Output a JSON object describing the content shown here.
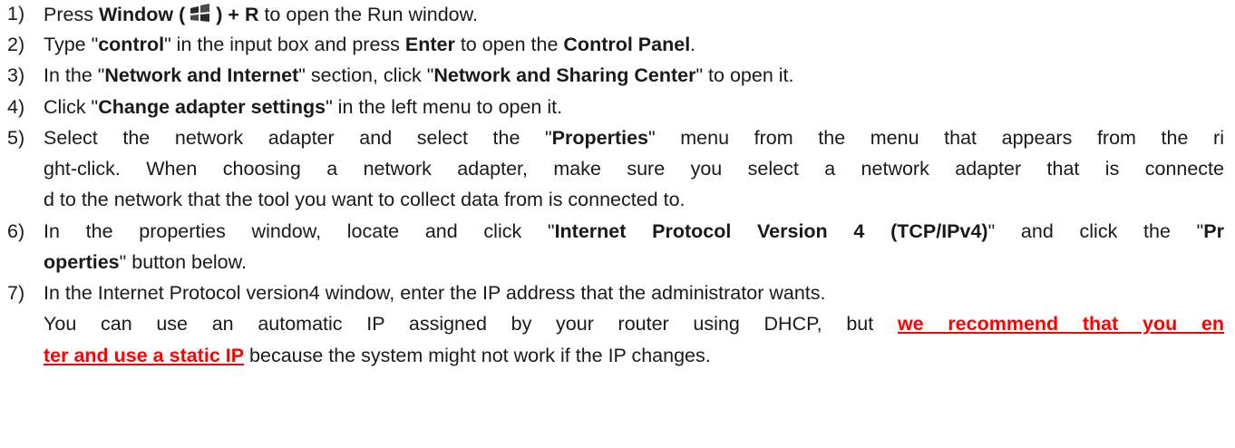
{
  "steps": [
    {
      "num": "1)",
      "lines": [
        [
          "Press ",
          {
            "b": "Window ("
          },
          "ICON",
          {
            "b": ") + R"
          },
          " to open the Run window."
        ]
      ]
    },
    {
      "num": "2)",
      "lines": [
        [
          "Type \"",
          {
            "b": "control"
          },
          "\" in the input box and press ",
          {
            "b": "Enter"
          },
          " to open the ",
          {
            "b": "Control Panel"
          },
          "."
        ]
      ]
    },
    {
      "num": "3)",
      "lines": [
        [
          "In the \"",
          {
            "b": "Network and Internet"
          },
          "\" section, click \"",
          {
            "b": "Network and Sharing Center"
          },
          "\" to open it."
        ]
      ]
    },
    {
      "num": "4)",
      "lines": [
        [
          "Click \"",
          {
            "b": "Change adapter settings"
          },
          "\" in the left menu to open it."
        ]
      ]
    },
    {
      "num": "5)",
      "lines": [
        [
          "Select the network adapter and select the \"",
          {
            "b": "Properties"
          },
          "\" menu from the menu that appears from the ri"
        ],
        [
          "ght-click. When choosing a network adapter, make sure you select a network adapter that is connecte"
        ],
        [
          "d to the network that the tool you want to collect data from is connected to."
        ]
      ]
    },
    {
      "num": "6)",
      "lines": [
        [
          "In the properties window, locate and click \"",
          {
            "b": "Internet Protocol Version 4 (TCP/IPv4)"
          },
          "\" and click the \"",
          {
            "b": "Pr"
          }
        ],
        [
          {
            "b": "operties"
          },
          "\" button below."
        ]
      ]
    },
    {
      "num": "7)",
      "lines": [
        [
          "In the Internet Protocol version4 window, enter the IP address that the administrator wants."
        ],
        [
          "You can use an automatic IP assigned by your router using DHCP, but ",
          {
            "w": "we recommend that you en"
          }
        ],
        [
          {
            "w": "ter and use a static IP"
          },
          " because the system might not work if the IP changes."
        ]
      ]
    }
  ],
  "icon": {
    "name": "windows-logo-icon",
    "colors": [
      "#2b2b2b",
      "#4a4a4a"
    ]
  },
  "warning_color": "#ff0000"
}
